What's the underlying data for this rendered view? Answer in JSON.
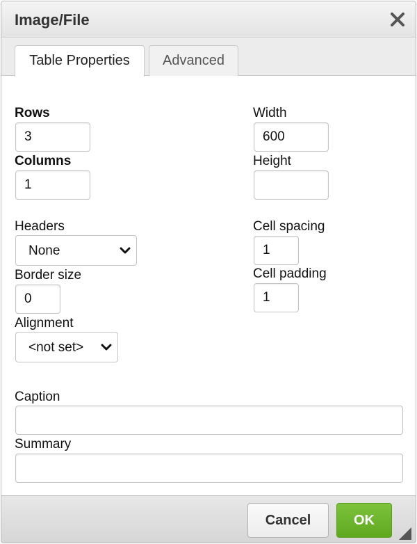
{
  "dialog": {
    "title": "Image/File",
    "close_icon": "close-icon"
  },
  "tabs": [
    {
      "label": "Table Properties",
      "active": true
    },
    {
      "label": "Advanced",
      "active": false
    }
  ],
  "form": {
    "rows": {
      "label": "Rows",
      "value": "3"
    },
    "columns": {
      "label": "Columns",
      "value": "1"
    },
    "width": {
      "label": "Width",
      "value": "600"
    },
    "height": {
      "label": "Height",
      "value": ""
    },
    "headers": {
      "label": "Headers",
      "value": "None"
    },
    "cell_spacing": {
      "label": "Cell spacing",
      "value": "1"
    },
    "border_size": {
      "label": "Border size",
      "value": "0"
    },
    "cell_padding": {
      "label": "Cell padding",
      "value": "1"
    },
    "alignment": {
      "label": "Alignment",
      "value": "<not set>"
    },
    "caption": {
      "label": "Caption",
      "value": ""
    },
    "summary": {
      "label": "Summary",
      "value": ""
    }
  },
  "footer": {
    "cancel_label": "Cancel",
    "ok_label": "OK",
    "ok_color": "#6ab52b"
  }
}
